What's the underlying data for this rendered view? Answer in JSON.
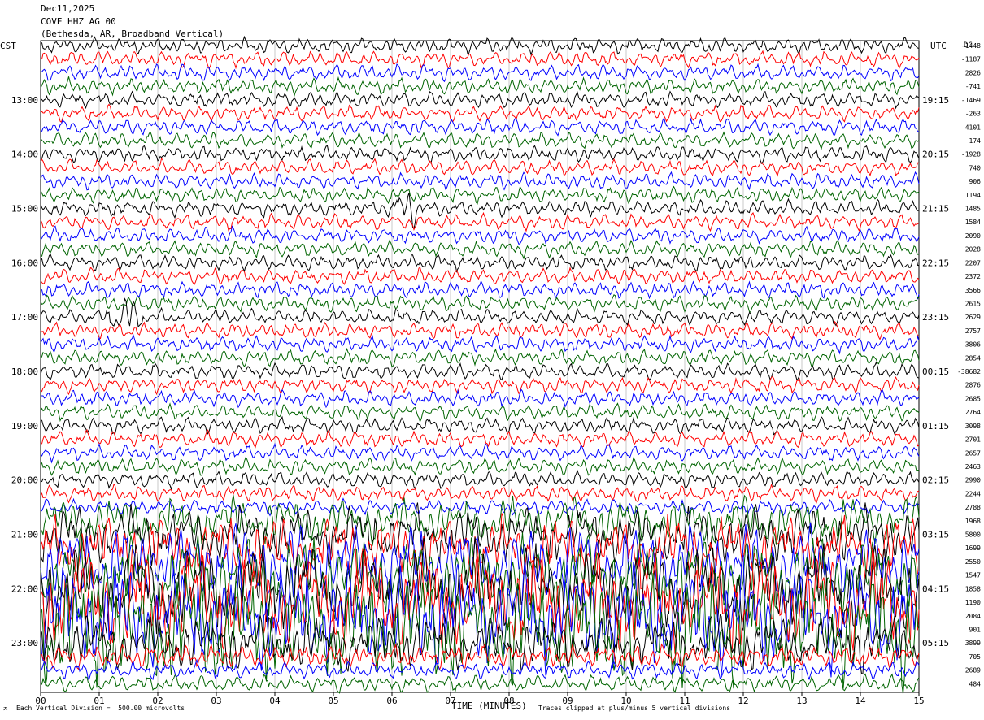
{
  "header": {
    "date": "Dec11,2025",
    "station": "COVE HHZ AG 00",
    "location": "(Bethesda, AR, Broadband Vertical)"
  },
  "left_zone_label": "CST",
  "right_zone_label": "UTC",
  "dc_label": "DC",
  "footer": {
    "left_mark": "ㅈ",
    "scale_text": "Each Vertical Division =  500.00 microvolts",
    "xlabel": "TIME (MINUTES)",
    "clip_text": "Traces clipped at plus/minus 5 vertical divisions"
  },
  "chart_data": {
    "type": "line",
    "title": "",
    "xlabel": "TIME (MINUTES)",
    "x_ticks": [
      "00",
      "01",
      "02",
      "03",
      "04",
      "05",
      "06",
      "07",
      "08",
      "09",
      "10",
      "11",
      "12",
      "13",
      "14",
      "15"
    ],
    "xlim": [
      0,
      15
    ],
    "traces_per_hour": 4,
    "trace_count": 48,
    "trace_colors": [
      "#000000",
      "#ff0000",
      "#0000ff",
      "#006400"
    ],
    "left_hour_labels": [
      "13:00",
      "14:00",
      "15:00",
      "16:00",
      "17:00",
      "18:00",
      "19:00",
      "20:00",
      "21:00",
      "22:00",
      "23:00"
    ],
    "left_label_first_trace": 4,
    "right_hour_labels": [
      "19:15",
      "20:15",
      "21:15",
      "22:15",
      "23:15",
      "00:15",
      "01:15",
      "02:15",
      "03:15",
      "04:15",
      "05:15"
    ],
    "dc_offsets": [
      "-1448",
      "-1187",
      "2826",
      "-741",
      "-1469",
      "-263",
      "4101",
      "174",
      "-1928",
      "740",
      "906",
      "1194",
      "1485",
      "1584",
      "2090",
      "2028",
      "2207",
      "2372",
      "3566",
      "2615",
      "2629",
      "2757",
      "3806",
      "2854",
      "-38682",
      "2876",
      "2685",
      "2764",
      "3098",
      "2701",
      "2657",
      "2463",
      "2990",
      "2244",
      "2788",
      "1968",
      "5800",
      "1699",
      "2550",
      "1547",
      "1858",
      "1190",
      "2084",
      "901",
      "3899",
      "705",
      "2689",
      "484"
    ],
    "grid": true,
    "clip_divisions": 5,
    "events": [
      {
        "trace": 12,
        "minute": 6.25,
        "label": ""
      },
      {
        "trace": 20,
        "minute": 1.45,
        "label": ""
      }
    ],
    "high_amplitude_start_trace": 35
  }
}
